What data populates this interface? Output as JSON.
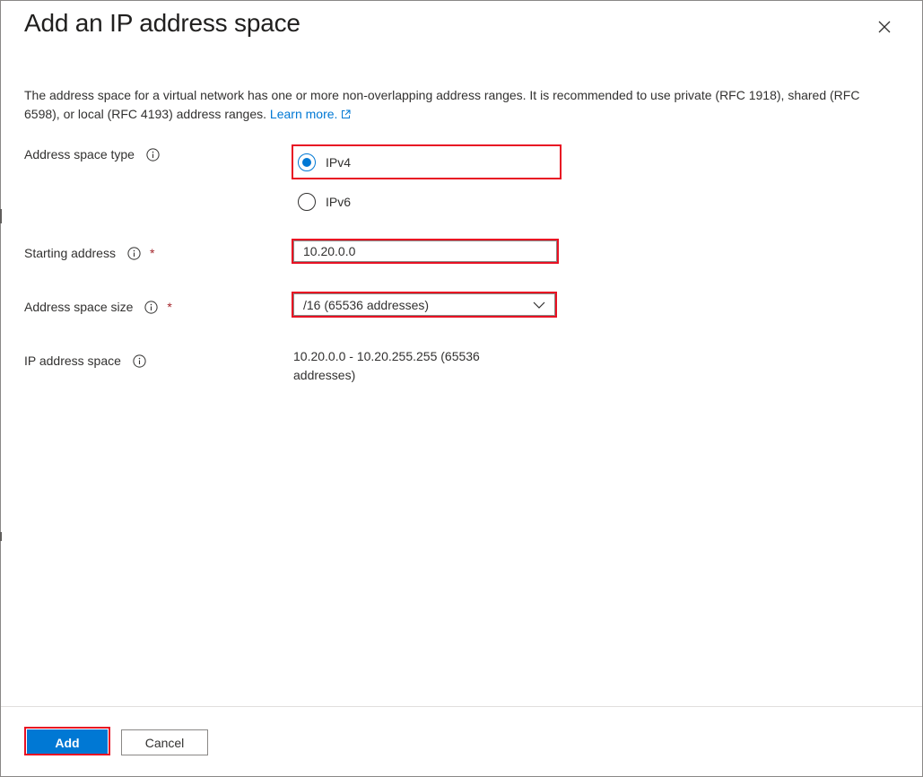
{
  "dialog": {
    "title": "Add an IP address space",
    "close_icon": "close-icon"
  },
  "description": {
    "text": "The address space for a virtual network has one or more non-overlapping address ranges. It is recommended to use private (RFC 1918), shared (RFC 6598), or local (RFC 4193) address ranges.",
    "link_label": "Learn more.",
    "link_icon": "external-link-icon"
  },
  "form": {
    "address_space_type": {
      "label": "Address space type",
      "options": [
        "IPv4",
        "IPv6"
      ],
      "selected": "IPv4"
    },
    "starting_address": {
      "label": "Starting address",
      "required_mark": "*",
      "value": "10.20.0.0"
    },
    "address_space_size": {
      "label": "Address space size",
      "required_mark": "*",
      "selected": "/16 (65536 addresses)"
    },
    "ip_address_space": {
      "label": "IP address space",
      "value": "10.20.0.0 - 10.20.255.255 (65536 addresses)"
    }
  },
  "footer": {
    "add_label": "Add",
    "cancel_label": "Cancel"
  },
  "colors": {
    "accent": "#0078d4",
    "highlight": "#e81123",
    "required": "#a4262c"
  }
}
